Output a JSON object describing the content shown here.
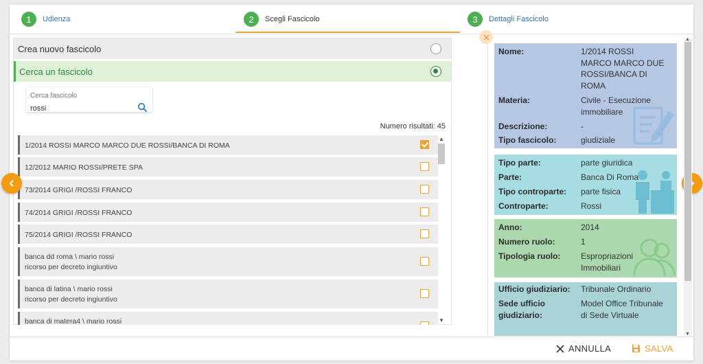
{
  "stepper": {
    "steps": [
      {
        "number": "1",
        "label": "Udienza"
      },
      {
        "number": "2",
        "label": "Scegli Fascicolo"
      },
      {
        "number": "3",
        "label": "Dettagli Fascicolo"
      }
    ],
    "active_step": 2
  },
  "options": {
    "create_label": "Crea nuovo fascicolo",
    "search_label": "Cerca un fascicolo",
    "selected": "search"
  },
  "search": {
    "label": "Cerca fascicolo",
    "value": "rossi",
    "results_label": "Numero risultati: 45"
  },
  "results": [
    {
      "line1": "1/2014 ROSSI MARCO MARCO DUE ROSSI/BANCA DI ROMA",
      "line2": "",
      "checked": true
    },
    {
      "line1": "12/2012 MARIO ROSSI/PRETE SPA",
      "line2": "",
      "checked": false
    },
    {
      "line1": "73/2014 GRIGI /ROSSI FRANCO",
      "line2": "",
      "checked": false
    },
    {
      "line1": "74/2014 GRIGI /ROSSI FRANCO",
      "line2": "",
      "checked": false
    },
    {
      "line1": "75/2014 GRIGI /ROSSI FRANCO",
      "line2": "",
      "checked": false
    },
    {
      "line1": "banca dd roma \\ mario rossi",
      "line2": "ricorso per decreto ingiuntivo",
      "checked": false
    },
    {
      "line1": "banca di latina \\ mario rossi",
      "line2": "ricorso per decreto ingiuntivo",
      "checked": false
    },
    {
      "line1": "banca di matera4 \\ mario rossi",
      "line2": "",
      "checked": false
    }
  ],
  "details": {
    "card1": {
      "nome_k": "Nome:",
      "nome_v": "1/2014 ROSSI MARCO MARCO DUE ROSSI/BANCA DI ROMA",
      "materia_k": "Materia:",
      "materia_v": "Civile - Esecuzione immobiliare",
      "descr_k": "Descrizione:",
      "descr_v": "-",
      "tipo_k": "Tipo fascicolo:",
      "tipo_v": "giudiziale"
    },
    "card2": {
      "tp_k": "Tipo parte:",
      "tp_v": "parte giuridica",
      "p_k": "Parte:",
      "p_v": "Banca Di Roma",
      "tc_k": "Tipo controparte:",
      "tc_v": "parte fisica",
      "c_k": "Controparte:",
      "c_v": "Rossi"
    },
    "card3": {
      "anno_k": "Anno:",
      "anno_v": "2014",
      "nr_k": "Numero ruolo:",
      "nr_v": "1",
      "tr_k": "Tipologia ruolo:",
      "tr_v": "Espropriazioni Immobiliari"
    },
    "card4": {
      "ug_k": "Ufficio giudiziario:",
      "ug_v": "Tribunale Ordinario",
      "su_k": "Sede ufficio giudiziario:",
      "su_v": "Model Office Tribunale di Sede Virtuale"
    }
  },
  "footer": {
    "cancel_label": "ANNULLA",
    "save_label": "SALVA"
  },
  "colors": {
    "accent": "#e8a33a",
    "step_green": "#4caf50",
    "card1": "#b6c7e4",
    "card2": "#a6dde3",
    "card3": "#acd8ae",
    "card4": "#a9d3d7"
  }
}
